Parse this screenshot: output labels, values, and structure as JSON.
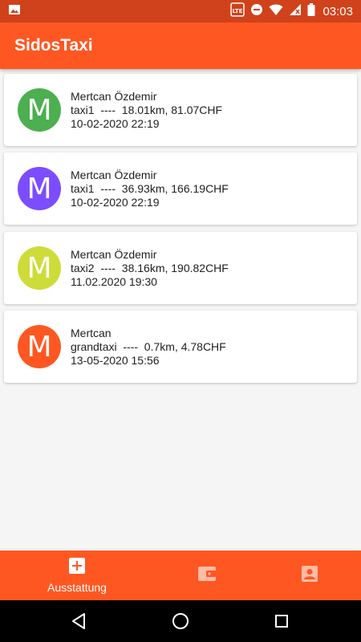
{
  "status_bar": {
    "time": "03:03",
    "network_label": "LTE",
    "icons": [
      "image-icon",
      "volte-icon",
      "do-not-disturb-icon",
      "wifi-icon",
      "signal-icon",
      "battery-icon"
    ]
  },
  "app_bar": {
    "title": "SidosTaxi",
    "background": "#ff5722"
  },
  "rides": [
    {
      "initial": "M",
      "avatar_color": "#4caf50",
      "name": "Mertcan Özdemir",
      "details": "taxi1  ----  18.01km, 81.07CHF",
      "datetime": "10-02-2020 22:19"
    },
    {
      "initial": "M",
      "avatar_color": "#7c4dff",
      "name": "Mertcan Özdemir",
      "details": "taxi1  ----  36.93km, 166.19CHF",
      "datetime": "10-02-2020 22:19"
    },
    {
      "initial": "M",
      "avatar_color": "#cddc39",
      "name": "Mertcan Özdemir",
      "details": "taxi2  ----  38.16km, 190.82CHF",
      "datetime": "11.02.2020 19:30"
    },
    {
      "initial": "M",
      "avatar_color": "#ff5722",
      "name": "Mertcan",
      "details": "grandtaxi  ----  0.7km, 4.78CHF",
      "datetime": "13-05-2020 15:56"
    }
  ],
  "bottom_nav": {
    "items": [
      {
        "label": "Ausstattung",
        "icon": "add-box-icon",
        "active": true
      },
      {
        "label": "",
        "icon": "wallet-icon",
        "active": false
      },
      {
        "label": "",
        "icon": "account-box-icon",
        "active": false
      }
    ]
  },
  "system_nav": {
    "icons": [
      "back-icon",
      "home-icon",
      "recents-icon"
    ]
  }
}
